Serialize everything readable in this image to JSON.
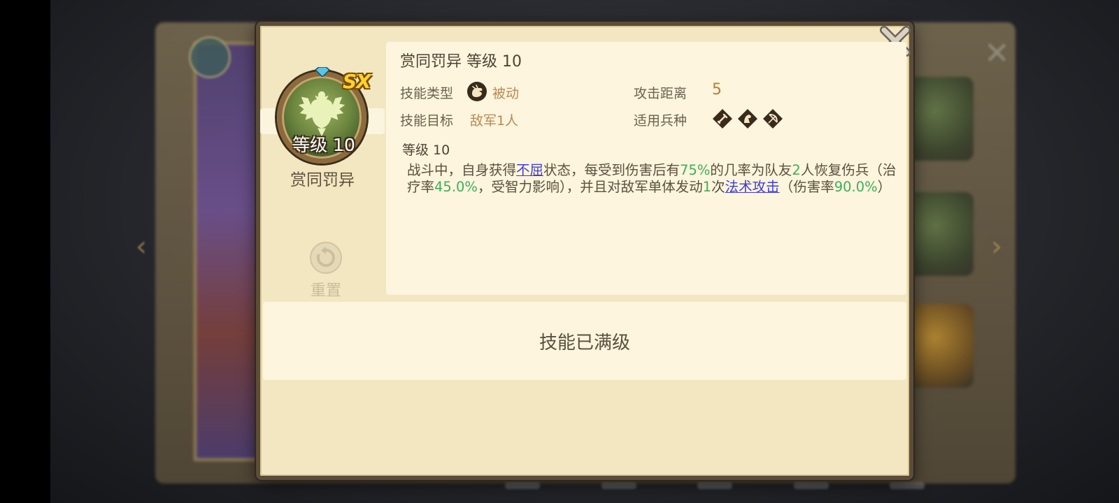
{
  "skill": {
    "name": "赏同罚异",
    "badge": "SX",
    "level_text": "等级 10",
    "title_level": "等级 10"
  },
  "attributes": {
    "type_label": "技能类型",
    "type_value": "被动",
    "type_icon": "fist-icon",
    "range_label": "攻击距离",
    "range_value": "5",
    "target_label": "技能目标",
    "target_value": "敌军1人",
    "troop_label": "适用兵种",
    "troop_icons": [
      "infantry-icon",
      "cavalry-icon",
      "archer-icon"
    ]
  },
  "description": {
    "level_heading": "等级 10",
    "part1": "战斗中，自身获得",
    "link1": "不屈",
    "part2": "状态，每受到伤害后有",
    "num1": "75%",
    "part3": "的几率为队友",
    "num2": "2",
    "part4": "人恢复伤兵（治疗率",
    "num3": "45.0%",
    "part5": "，受智力影响），并且对敌军单体发动",
    "num4": "1",
    "part6": "次",
    "link2": "法术攻击",
    "part7": "（伤害率",
    "num5": "90.0%",
    "part8": "）"
  },
  "reset": {
    "label": "重置"
  },
  "status": {
    "maxed": "技能已满级"
  },
  "colors": {
    "highlight_green": "#3fae5c",
    "link_blue": "#3f3cd8",
    "value_orange": "#b88954",
    "badge_gold": "#ffd32a"
  }
}
